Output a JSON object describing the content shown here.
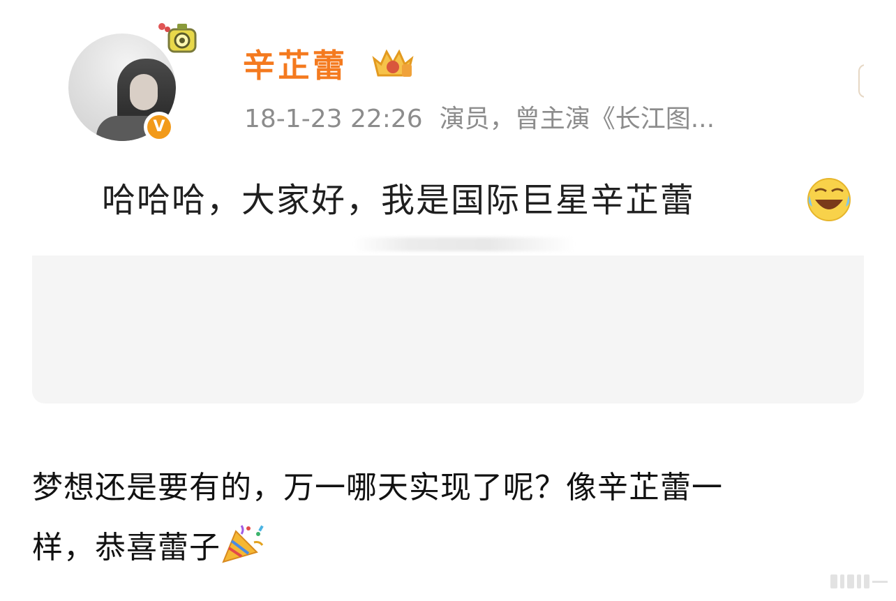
{
  "post_card": {
    "username": "辛芷蕾",
    "timestamp": "18-1-23 22:26",
    "bio": "演员，曾主演《长江图...",
    "text": "哈哈哈，大家好，我是国际巨星辛芷蕾",
    "badge_letter": "V"
  },
  "caption": {
    "line1": "梦想还是要有的，万一哪天实现了呢？像辛芷蕾一",
    "line2": "样，恭喜蕾子"
  },
  "colors": {
    "username": "#f47a1f",
    "meta": "#8c8c8c",
    "badge": "#f29a1a",
    "card_bg": "#f5f5f5"
  },
  "icons": [
    "avatar-pendant-icon",
    "crown-level-icon",
    "verified-v-icon",
    "laugh-cry-emoji-icon",
    "party-popper-emoji-icon"
  ]
}
